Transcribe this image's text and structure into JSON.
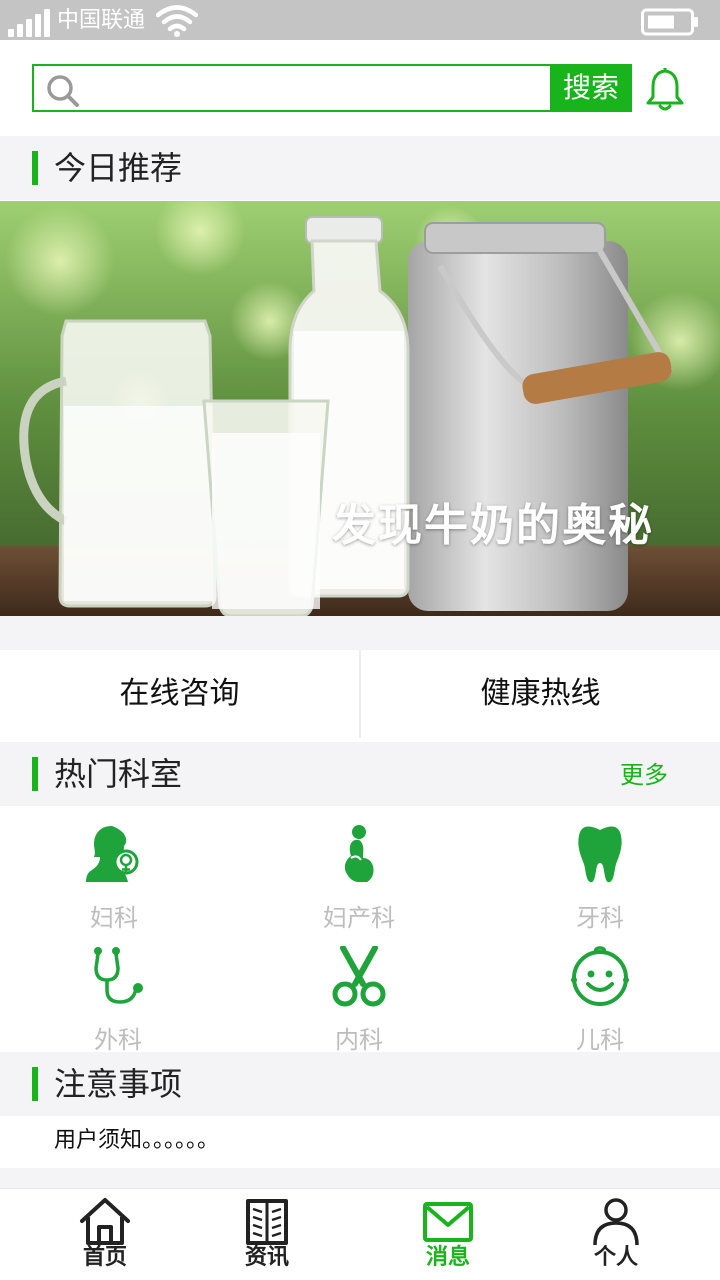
{
  "status_bar": {
    "carrier": "中国联通"
  },
  "search": {
    "placeholder": "",
    "button_label": "搜索"
  },
  "today": {
    "title": "今日推荐"
  },
  "banner": {
    "caption": "发现牛奶的奥秘",
    "slide_count": 3,
    "active_slide": 2
  },
  "quick": {
    "consult": "在线咨询",
    "hotline": "健康热线"
  },
  "departments": {
    "title": "热门科室",
    "more": "更多",
    "items": [
      {
        "label": "妇科",
        "icon": "gynecology-icon"
      },
      {
        "label": "妇产科",
        "icon": "obstetrics-icon"
      },
      {
        "label": "牙科",
        "icon": "tooth-icon"
      },
      {
        "label": "外科",
        "icon": "stethoscope-icon"
      },
      {
        "label": "内科",
        "icon": "scissors-icon"
      },
      {
        "label": "儿科",
        "icon": "baby-face-icon"
      }
    ]
  },
  "notice": {
    "title": "注意事项",
    "text": "用户须知。。。。。。"
  },
  "tabbar": {
    "items": [
      {
        "label": "首页",
        "icon": "home-icon"
      },
      {
        "label": "资讯",
        "icon": "book-icon"
      },
      {
        "label": "消息",
        "icon": "mail-icon",
        "active": true
      },
      {
        "label": "个人",
        "icon": "person-icon"
      }
    ]
  },
  "colors": {
    "accent": "#19b41c",
    "section_bg": "#f4f3f5",
    "status_bg": "#c4c4c4",
    "muted_label": "#bdbdbd"
  }
}
